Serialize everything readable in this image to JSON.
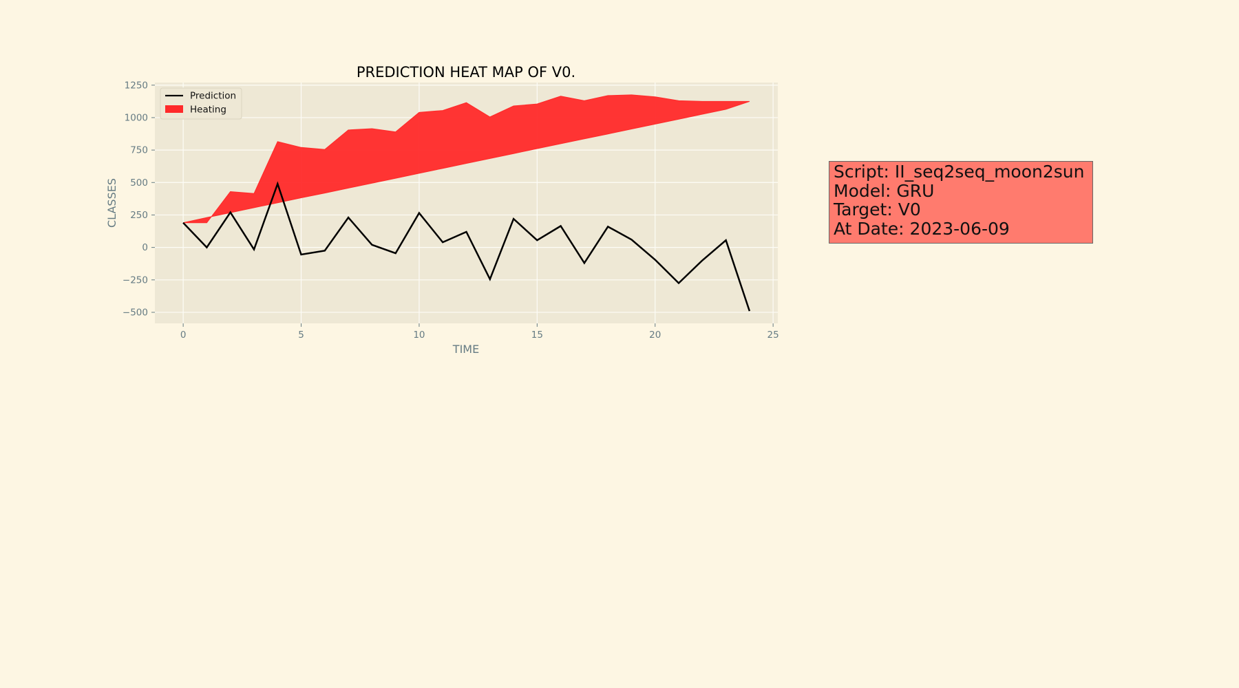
{
  "chart_data": {
    "type": "line",
    "title": "PREDICTION HEAT MAP OF V0.",
    "xlabel": "TIME",
    "ylabel": "CLASSES",
    "xlim": [
      -1.2,
      25.2
    ],
    "ylim": [
      -585,
      1270
    ],
    "xticks": [
      0,
      5,
      10,
      15,
      20,
      25
    ],
    "yticks": [
      1250,
      1000,
      750,
      500,
      250,
      0,
      -250,
      -500
    ],
    "ytick_labels": [
      "1250",
      "1000",
      "750",
      "500",
      "250",
      "0",
      "−250",
      "−500"
    ],
    "grid": true,
    "legend_position": "top-left",
    "legend": [
      {
        "label": "Prediction",
        "kind": "line",
        "color": "#000000"
      },
      {
        "label": "Heating",
        "kind": "patch",
        "color": "#ff2a2a"
      }
    ],
    "series": [
      {
        "name": "Prediction",
        "type": "line",
        "color": "#000000",
        "x": [
          0,
          1,
          2,
          3,
          4,
          5,
          6,
          7,
          8,
          9,
          10,
          11,
          12,
          13,
          14,
          15,
          16,
          17,
          18,
          19,
          20,
          21,
          22,
          23,
          24
        ],
        "y": [
          190,
          0,
          270,
          -15,
          490,
          -55,
          -25,
          230,
          20,
          -45,
          265,
          40,
          120,
          -245,
          220,
          55,
          165,
          -120,
          160,
          60,
          -95,
          -275,
          -100,
          55,
          -490
        ]
      },
      {
        "name": "Heating",
        "type": "area",
        "color": "#ff2a2a",
        "x": [
          0,
          1,
          2,
          3,
          4,
          5,
          6,
          7,
          8,
          9,
          10,
          11,
          12,
          13,
          14,
          15,
          16,
          17,
          18,
          19,
          20,
          21,
          22,
          23,
          24
        ],
        "upper": [
          190,
          190,
          430,
          415,
          815,
          770,
          755,
          905,
          915,
          890,
          1040,
          1055,
          1115,
          1005,
          1090,
          1105,
          1165,
          1130,
          1170,
          1175,
          1160,
          1130,
          1125,
          1125,
          1125
        ],
        "lower": [
          190,
          230,
          268,
          306,
          344,
          382,
          419,
          457,
          495,
          533,
          571,
          609,
          647,
          685,
          723,
          761,
          799,
          837,
          874,
          912,
          950,
          988,
          1026,
          1064,
          1125
        ]
      }
    ]
  },
  "infobox": {
    "line1": "Script: II_seq2seq_moon2sun",
    "line2": "Model: GRU",
    "line3": "Target: V0",
    "line4": "At Date: 2023-06-09"
  },
  "colors": {
    "figure_bg": "#fdf6e3",
    "axes_bg": "#eee8d5",
    "grid": "#fdfcf7",
    "tick_text": "#657b83",
    "infobox_bg": "#ff7b6e"
  }
}
